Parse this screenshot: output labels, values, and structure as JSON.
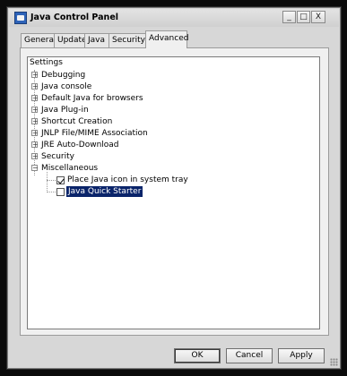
{
  "window": {
    "title": "Java Control Panel",
    "controls": {
      "minimize": "_",
      "maximize": "□",
      "close": "X"
    }
  },
  "tabs": [
    {
      "label": "General"
    },
    {
      "label": "Update"
    },
    {
      "label": "Java"
    },
    {
      "label": "Security"
    },
    {
      "label": "Advanced",
      "active": true
    }
  ],
  "tree": {
    "root": "Settings",
    "items": [
      {
        "label": "Debugging",
        "expander": "+"
      },
      {
        "label": "Java console",
        "expander": "+"
      },
      {
        "label": "Default Java for browsers",
        "expander": "+"
      },
      {
        "label": "Java Plug-in",
        "expander": "+"
      },
      {
        "label": "Shortcut Creation",
        "expander": "+"
      },
      {
        "label": "JNLP File/MIME Association",
        "expander": "+"
      },
      {
        "label": "JRE Auto-Download",
        "expander": "+"
      },
      {
        "label": "Security",
        "expander": "+"
      },
      {
        "label": "Miscellaneous",
        "expander": "−"
      }
    ],
    "misc_children": [
      {
        "label": "Place Java icon in system tray",
        "checked": true
      },
      {
        "label": "Java Quick Starter",
        "checked": false,
        "selected": true
      }
    ]
  },
  "buttons": {
    "ok": "OK",
    "cancel": "Cancel",
    "apply": "Apply"
  },
  "colors": {
    "selection": "#0a246a",
    "background": "#d7d7d7"
  }
}
